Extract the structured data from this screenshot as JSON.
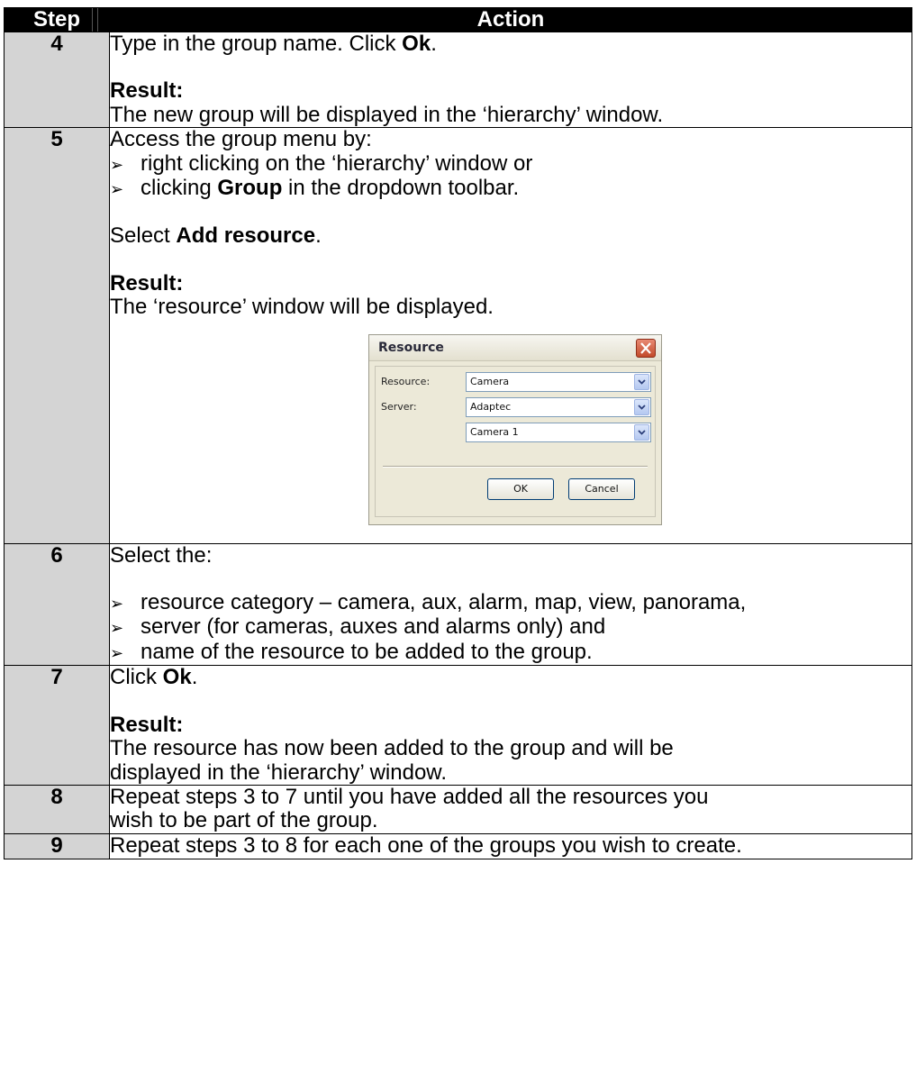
{
  "table": {
    "header": {
      "step": "Step",
      "action": "Action"
    }
  },
  "rows": [
    {
      "step": "4",
      "l1_pre": "Type in the group name.  Click ",
      "l1_bold": "Ok",
      "l1_post": ".",
      "result_label": "Result:",
      "result_text": "The new group will be displayed in the ‘hierarchy’ window."
    },
    {
      "step": "5",
      "intro": "Access the group menu by:",
      "bullet1": "right clicking on the ‘hierarchy’ window or",
      "bullet2_pre": "clicking ",
      "bullet2_bold": "Group",
      "bullet2_post": " in the dropdown toolbar.",
      "select_pre": "Select ",
      "select_bold": "Add resource",
      "select_post": ".",
      "result_label": "Result:",
      "result_text": "The ‘resource’ window will be displayed."
    },
    {
      "step": "6",
      "intro": "Select the:",
      "bullet1": "resource category – camera, aux, alarm, map, view, panorama,",
      "bullet2": "server (for cameras, auxes and alarms only) and",
      "bullet3": "name of the resource to be added to the group."
    },
    {
      "step": "7",
      "l1_pre": "Click ",
      "l1_bold": "Ok",
      "l1_post": ".",
      "result_label": "Result:",
      "result_line1": "The resource has now been added to the group and will be",
      "result_line2": "displayed in the ‘hierarchy’ window."
    },
    {
      "step": "8",
      "line1": "Repeat steps 3 to 7 until you have added all the resources you",
      "line2": "wish to be part of the group."
    },
    {
      "step": "9",
      "line1": "Repeat steps 3 to 8 for each one of the groups you wish to create."
    }
  ],
  "dialog": {
    "title": "Resource",
    "resource_label": "Resource:",
    "resource_value": "Camera",
    "server_label": "Server:",
    "server_value": "Adaptec",
    "item_value": "Camera 1",
    "ok_label": "OK",
    "cancel_label": "Cancel"
  },
  "bullet_glyph": "➢"
}
